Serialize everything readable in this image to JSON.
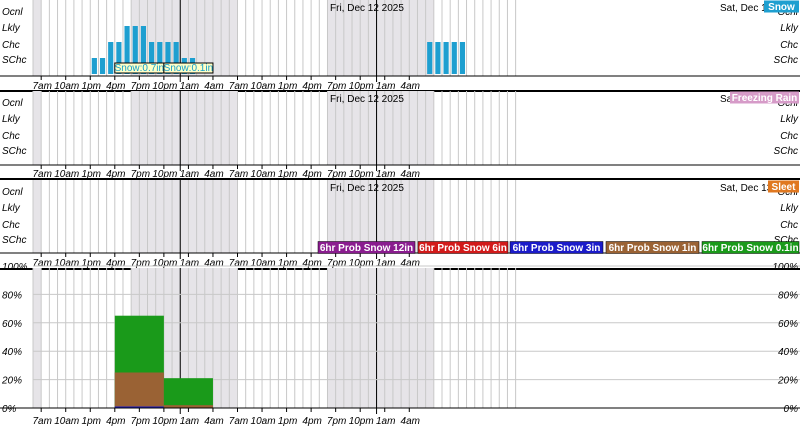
{
  "chart_data": [
    {
      "type": "bar",
      "name": "snow-panel",
      "tag_label": "Snow",
      "tag_color": "#1e9fd0",
      "bar_color": "#1e9fd0",
      "date_labels": [
        "Fri, Dec 12 2025",
        "Sat, Dec 1"
      ],
      "categories": [
        "SChc",
        "Chc",
        "Lkly",
        "Ocnl"
      ],
      "x_tick_labels": [
        "7am",
        "10am",
        "1pm",
        "4pm",
        "7pm",
        "10pm",
        "1am",
        "4am",
        "7am",
        "10am",
        "1pm",
        "4pm",
        "7pm",
        "10pm",
        "1am",
        "4am"
      ],
      "hourly_level": [
        0,
        0,
        0,
        0,
        0,
        0,
        0,
        1,
        1,
        2,
        2,
        3,
        3,
        3,
        2,
        2,
        2,
        2,
        1,
        1,
        0,
        0,
        0,
        0,
        0,
        0,
        0,
        0,
        0,
        0,
        0,
        0,
        0,
        0,
        0,
        0,
        0,
        0,
        0,
        0,
        0,
        0,
        0,
        0,
        0,
        0,
        0,
        0,
        2,
        2,
        2,
        2,
        2,
        0
      ],
      "annotations": [
        {
          "text": "Snow:0.7in",
          "start_hour": 10,
          "end_hour": 16
        },
        {
          "text": "Snow:0.1in",
          "start_hour": 16,
          "end_hour": 22
        }
      ]
    },
    {
      "type": "bar",
      "name": "freezing-rain-panel",
      "tag_label": "Freezing Rain",
      "tag_color": "#d69bc8",
      "bar_color": "#d69bc8",
      "date_labels": [
        "Fri, Dec 12 2025",
        "Sat, Dec"
      ],
      "categories": [
        "SChc",
        "Chc",
        "Lkly",
        "Ocnl"
      ],
      "x_tick_labels": [
        "7am",
        "10am",
        "1pm",
        "4pm",
        "7pm",
        "10pm",
        "1am",
        "4am",
        "7am",
        "10am",
        "1pm",
        "4pm",
        "7pm",
        "10pm",
        "1am",
        "4am"
      ],
      "hourly_level": []
    },
    {
      "type": "bar",
      "name": "sleet-panel",
      "tag_label": "Sleet",
      "tag_color": "#e07820",
      "bar_color": "#e07820",
      "date_labels": [
        "Fri, Dec 12 2025",
        "Sat, Dec 13"
      ],
      "categories": [
        "SChc",
        "Chc",
        "Lkly",
        "Ocnl"
      ],
      "x_tick_labels": [
        "7am",
        "10am",
        "1pm",
        "4pm",
        "7pm",
        "10pm",
        "1am",
        "4am",
        "7am",
        "10am",
        "1pm",
        "4pm",
        "7pm",
        "10pm",
        "1am",
        "4am"
      ],
      "hourly_level": []
    },
    {
      "type": "bar",
      "name": "snow-probability-panel",
      "y_tick_labels": [
        "0%",
        "20%",
        "40%",
        "60%",
        "80%",
        "100%"
      ],
      "ylim": [
        0,
        100
      ],
      "x_tick_labels": [
        "7am",
        "10am",
        "1pm",
        "4pm",
        "7pm",
        "10pm",
        "1am",
        "4am",
        "7am",
        "10am",
        "1pm",
        "4pm",
        "7pm",
        "10pm",
        "1am",
        "4am"
      ],
      "legend": [
        {
          "label": "6hr Prob Snow 12in",
          "color": "#8a1c8f"
        },
        {
          "label": "6hr Prob Snow 6in",
          "color": "#d21a1a"
        },
        {
          "label": "6hr Prob Snow 3in",
          "color": "#1b1bc9"
        },
        {
          "label": "6hr Prob Snow 1in",
          "color": "#9a6234"
        },
        {
          "label": "6hr Prob Snow 0.1in",
          "color": "#1a9a1a"
        }
      ],
      "periods": [
        {
          "start_hour": 10,
          "end_hour": 16,
          "values": {
            "12in": 0,
            "6in": 0,
            "3in": 1,
            "1in": 25,
            "0.1in": 65
          }
        },
        {
          "start_hour": 16,
          "end_hour": 22,
          "values": {
            "12in": 0,
            "6in": 0,
            "3in": 0,
            "1in": 2,
            "0.1in": 21
          }
        }
      ]
    }
  ]
}
